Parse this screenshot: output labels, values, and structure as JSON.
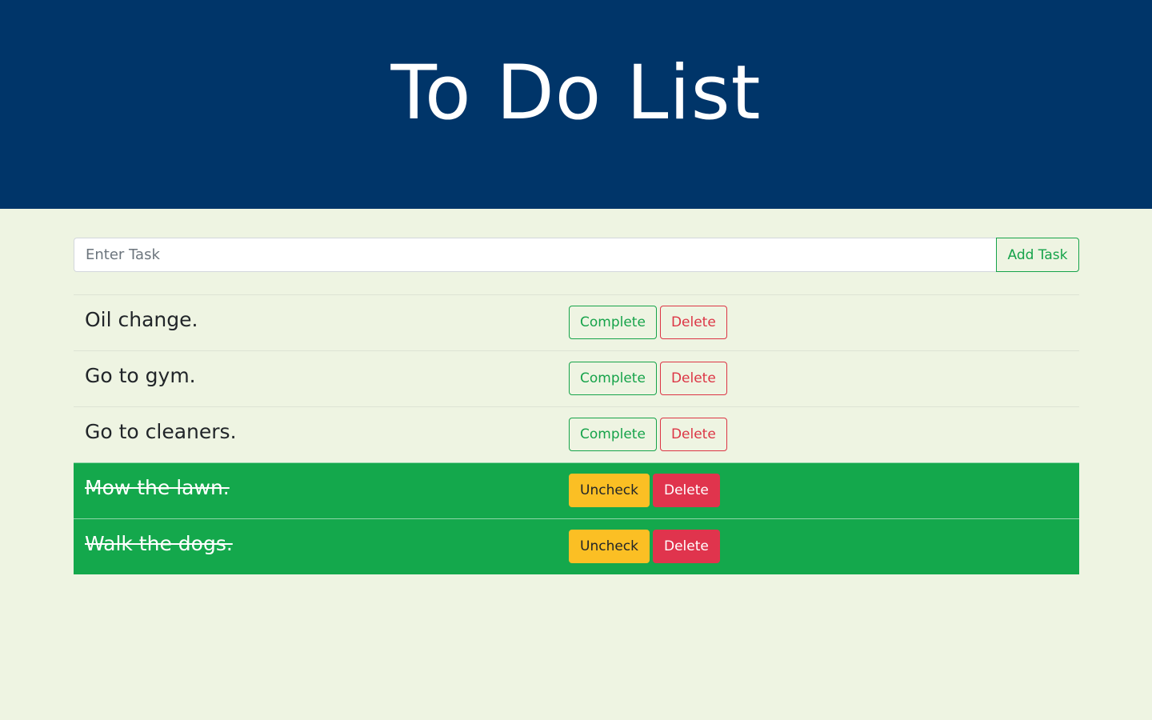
{
  "header": {
    "title": "To Do List"
  },
  "add_form": {
    "placeholder": "Enter Task",
    "value": "",
    "add_label": "Add Task"
  },
  "tasks": [
    {
      "text": "Oil change.",
      "completed": false,
      "toggle_label": "Complete",
      "delete_label": "Delete"
    },
    {
      "text": "Go to gym.",
      "completed": false,
      "toggle_label": "Complete",
      "delete_label": "Delete"
    },
    {
      "text": "Go to cleaners.",
      "completed": false,
      "toggle_label": "Complete",
      "delete_label": "Delete"
    },
    {
      "text": "Mow the lawn.",
      "completed": true,
      "toggle_label": "Uncheck",
      "delete_label": "Delete"
    },
    {
      "text": "Walk the dogs.",
      "completed": true,
      "toggle_label": "Uncheck",
      "delete_label": "Delete"
    }
  ],
  "colors": {
    "header_bg": "#003569",
    "page_bg": "#eef4e2",
    "success": "#16a34a",
    "completed_row": "#14a84c",
    "danger": "#dc3545",
    "warning": "#fbbf24"
  }
}
